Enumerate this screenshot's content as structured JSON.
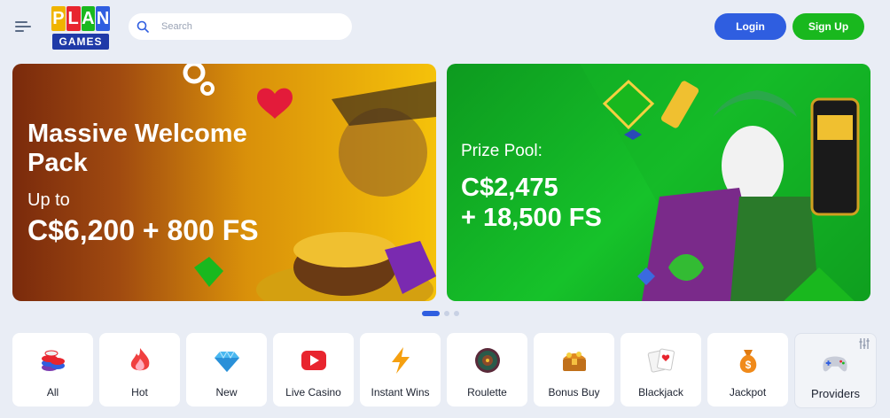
{
  "header": {
    "logo_top": [
      "P",
      "L",
      "A",
      "N"
    ],
    "logo_bottom": "GAMES",
    "search_placeholder": "Search",
    "login_label": "Login",
    "signup_label": "Sign Up"
  },
  "banners": [
    {
      "title": "Massive Welcome Pack",
      "line2": "Up to",
      "amount": "C$6,200 + 800 FS"
    },
    {
      "title": "Prize Pool:",
      "amount_line1": "C$2,475",
      "amount_line2": "+ 18,500 FS"
    }
  ],
  "carousel": {
    "slides": 3,
    "active_slide": 1
  },
  "categories": [
    {
      "label": "All",
      "icon": "chips-icon"
    },
    {
      "label": "Hot",
      "icon": "flame-icon"
    },
    {
      "label": "New",
      "icon": "diamond-icon"
    },
    {
      "label": "Live Casino",
      "icon": "play-icon"
    },
    {
      "label": "Instant Wins",
      "icon": "lightning-icon"
    },
    {
      "label": "Roulette",
      "icon": "roulette-icon"
    },
    {
      "label": "Bonus Buy",
      "icon": "treasure-chest-icon"
    },
    {
      "label": "Blackjack",
      "icon": "cards-icon"
    },
    {
      "label": "Jackpot",
      "icon": "money-bag-icon"
    },
    {
      "label": "Providers",
      "icon": "gamepad-icon"
    }
  ],
  "colors": {
    "primary": "#2f5ee0",
    "signup": "#19b81e",
    "background": "#e9edf5"
  }
}
